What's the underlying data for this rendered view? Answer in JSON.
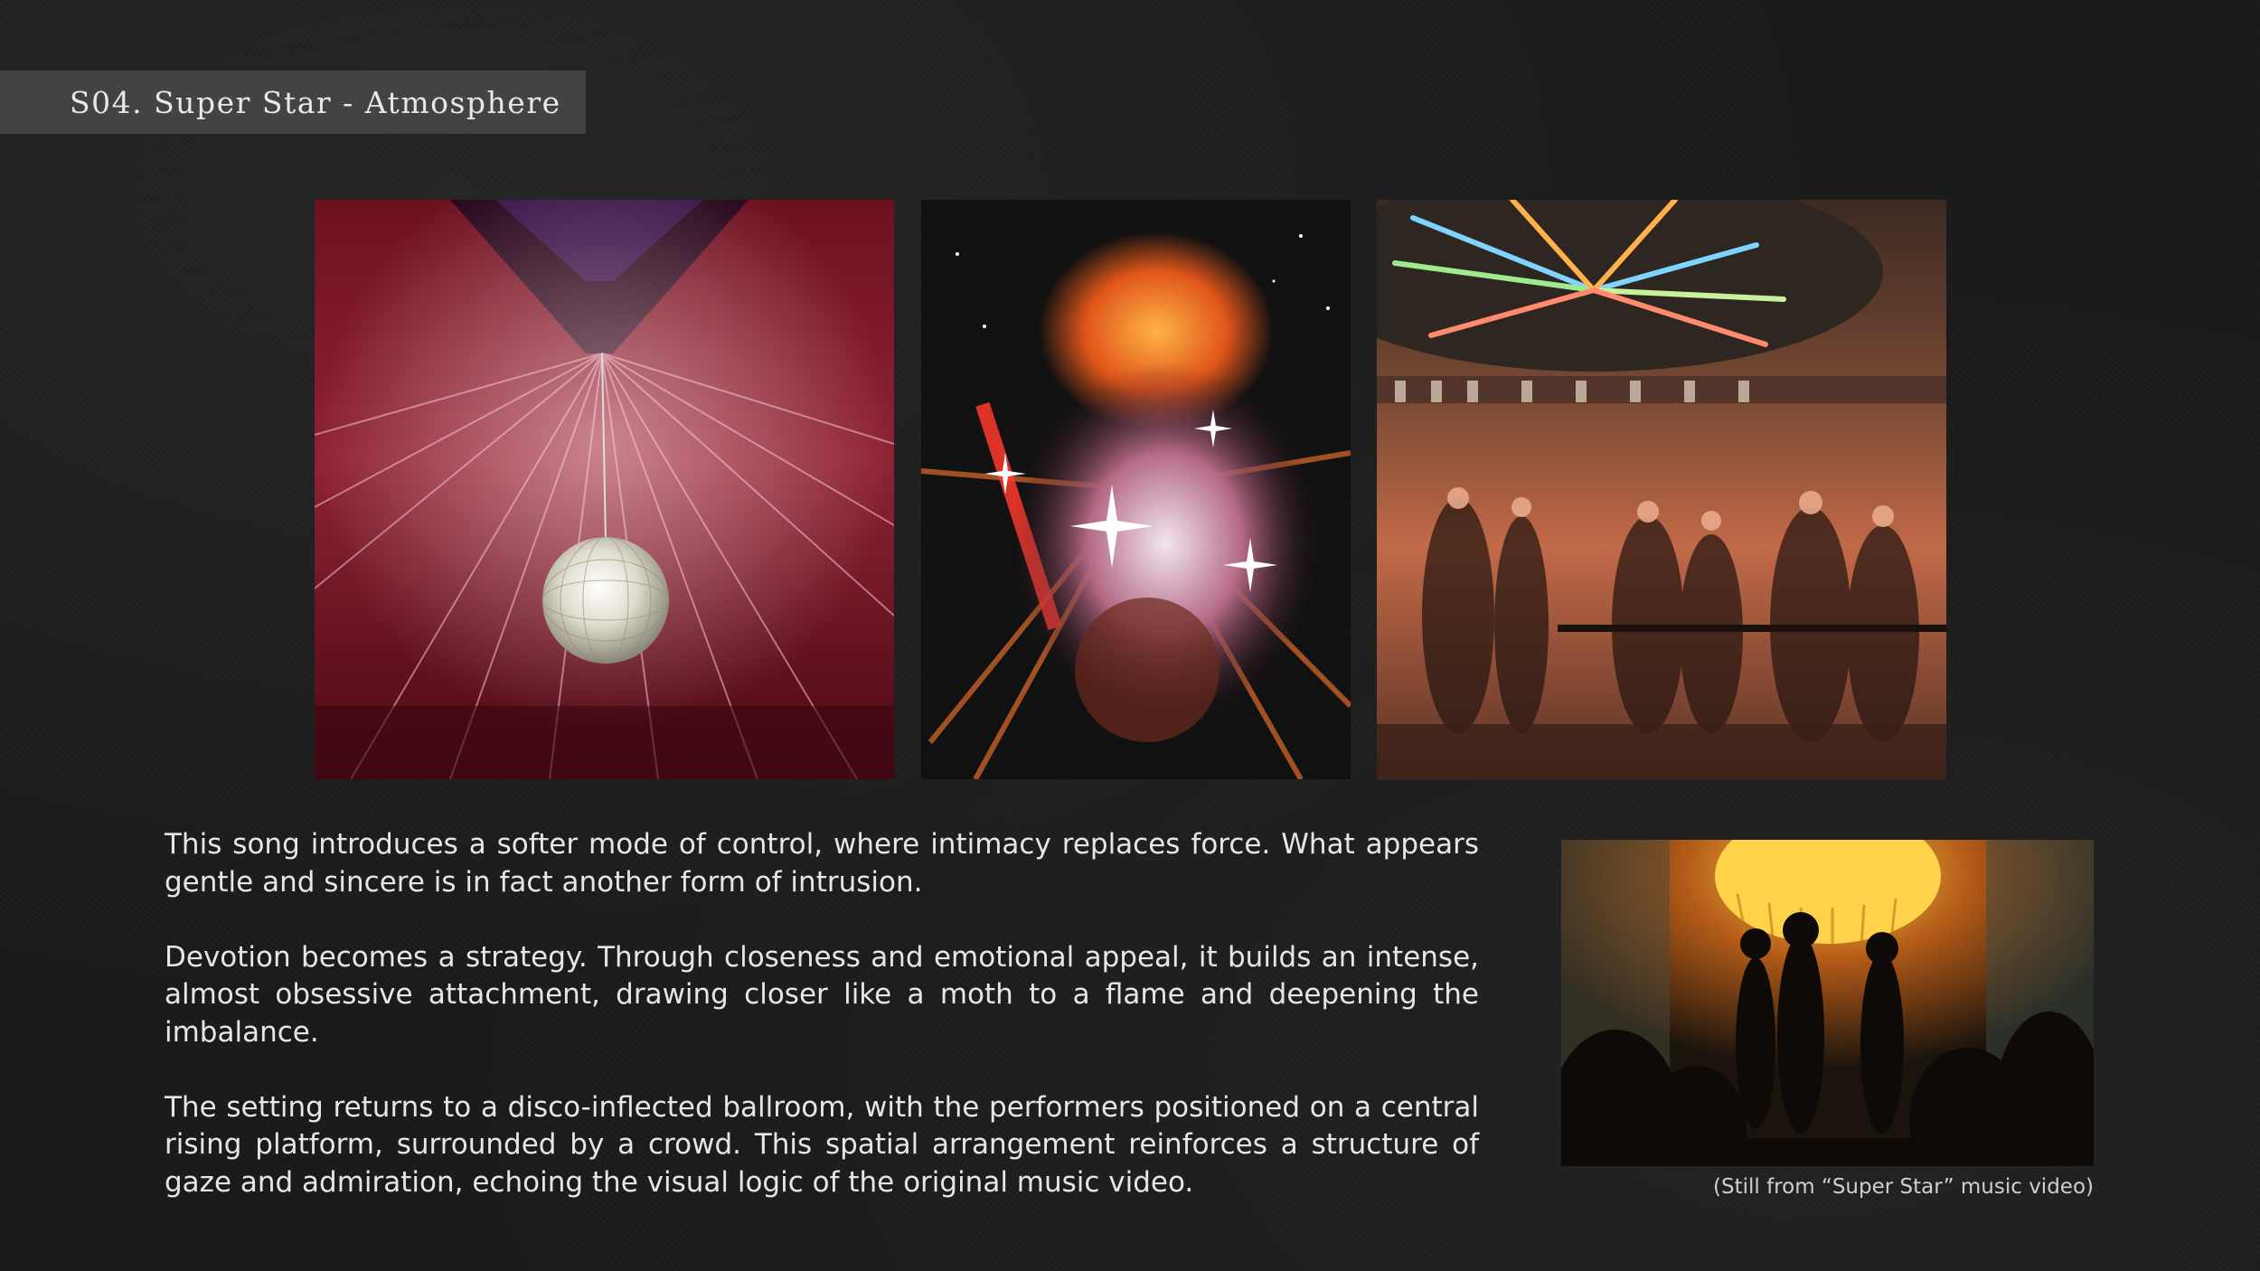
{
  "slide": {
    "title": "S04. Super Star - Atmosphere",
    "paragraphs": [
      "This song introduces a softer mode of control, where intimacy replaces force. What appears gentle and sincere is in fact another form of intrusion.",
      "Devotion becomes a strategy. Through closeness and emotional appeal, it builds an intense, almost obsessive attachment, drawing closer like a moth to a flame and deepening the imbalance.",
      "The setting returns to a disco-inflected ballroom, with the performers positioned on a central rising platform, surrounded by a crowd. This spatial arrangement reinforces a structure of gaze and admiration, echoing the visual logic of the original music video."
    ],
    "caption": "(Still from “Super Star” music video)"
  },
  "colors": {
    "background": "#1a1a1a",
    "title_bar": "#434343",
    "text": "#e6e6e6"
  }
}
